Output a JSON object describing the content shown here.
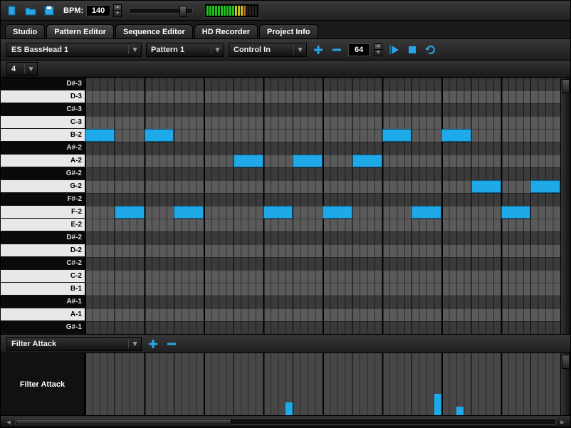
{
  "topbar": {
    "bpm_label": "BPM:",
    "bpm_value": "140"
  },
  "tabs": [
    "Studio",
    "Pattern Editor",
    "Sequence Editor",
    "HD Recorder",
    "Project Info"
  ],
  "active_tab": 1,
  "toolbar2": {
    "instrument": "ES BassHead 1",
    "pattern": "Pattern 1",
    "control": "Control In",
    "steps": "64"
  },
  "toolbar3": {
    "bars": "4"
  },
  "piano_keys": [
    {
      "label": "D#-3",
      "black": true
    },
    {
      "label": "D-3",
      "black": false
    },
    {
      "label": "C#-3",
      "black": true
    },
    {
      "label": "C-3",
      "black": false
    },
    {
      "label": "B-2",
      "black": false
    },
    {
      "label": "A#-2",
      "black": true
    },
    {
      "label": "A-2",
      "black": false
    },
    {
      "label": "G#-2",
      "black": true
    },
    {
      "label": "G-2",
      "black": false
    },
    {
      "label": "F#-2",
      "black": true
    },
    {
      "label": "F-2",
      "black": false
    },
    {
      "label": "E-2",
      "black": false
    },
    {
      "label": "D#-2",
      "black": true
    },
    {
      "label": "D-2",
      "black": false
    },
    {
      "label": "C#-2",
      "black": true
    },
    {
      "label": "C-2",
      "black": false
    },
    {
      "label": "B-1",
      "black": false
    },
    {
      "label": "A#-1",
      "black": true
    },
    {
      "label": "A-1",
      "black": false
    },
    {
      "label": "G#-1",
      "black": true
    }
  ],
  "notes": [
    {
      "row": 4,
      "col": 0,
      "len": 4
    },
    {
      "row": 4,
      "col": 8,
      "len": 4
    },
    {
      "row": 4,
      "col": 40,
      "len": 4
    },
    {
      "row": 4,
      "col": 48,
      "len": 4
    },
    {
      "row": 6,
      "col": 20,
      "len": 4
    },
    {
      "row": 6,
      "col": 28,
      "len": 4
    },
    {
      "row": 6,
      "col": 36,
      "len": 4
    },
    {
      "row": 8,
      "col": 52,
      "len": 4
    },
    {
      "row": 8,
      "col": 60,
      "len": 4
    },
    {
      "row": 10,
      "col": 4,
      "len": 4
    },
    {
      "row": 10,
      "col": 12,
      "len": 4
    },
    {
      "row": 10,
      "col": 24,
      "len": 4
    },
    {
      "row": 10,
      "col": 32,
      "len": 4
    },
    {
      "row": 10,
      "col": 44,
      "len": 4
    },
    {
      "row": 10,
      "col": 56,
      "len": 4
    }
  ],
  "automation": {
    "param": "Filter Attack",
    "label": "Filter Attack",
    "bars": [
      {
        "col": 27,
        "h": 18
      },
      {
        "col": 47,
        "h": 30
      },
      {
        "col": 50,
        "h": 12
      }
    ]
  }
}
